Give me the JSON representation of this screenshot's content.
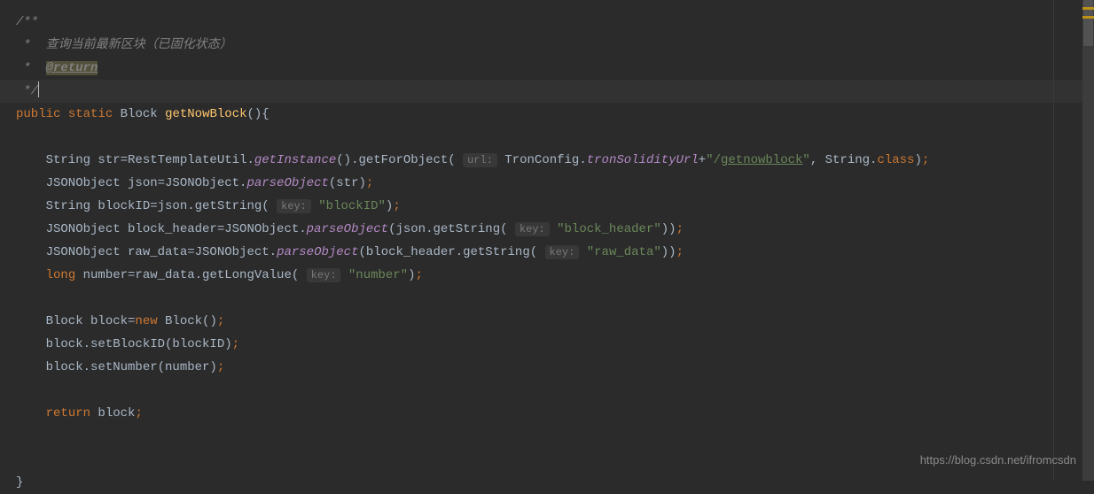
{
  "code": {
    "c1": "/**",
    "c2_star": " *  ",
    "c2_text": "查询当前最新区块（已固化状态）",
    "c3_star": " *  ",
    "c3_tag": "@return",
    "c4": " */",
    "l5_kw1": "public",
    "l5_kw2": "static",
    "l5_type": "Block",
    "l5_method": "getNowBlock",
    "l5_rest": "(){",
    "l7_a": "    String str=RestTemplateUtil.",
    "l7_m1": "getInstance",
    "l7_b": "().getForObject(",
    "l7_hint": "url:",
    "l7_c": " TronConfig.",
    "l7_sf": "tronSolidityUrl",
    "l7_d": "+",
    "l7_s1": "\"/",
    "l7_s2": "getnowblock",
    "l7_s3": "\"",
    "l7_e": ", String.",
    "l7_kw": "class",
    "l7_f": ")",
    "l7_semi": ";",
    "l8_a": "    JSONObject json=JSONObject.",
    "l8_m": "parseObject",
    "l8_b": "(str)",
    "l8_semi": ";",
    "l9_a": "    String blockID=json.getString(",
    "l9_hint": "key:",
    "l9_sp": " ",
    "l9_s": "\"blockID\"",
    "l9_b": ")",
    "l9_semi": ";",
    "l10_a": "    JSONObject block_header=JSONObject.",
    "l10_m": "parseObject",
    "l10_b": "(json.getString(",
    "l10_hint": "key:",
    "l10_sp": " ",
    "l10_s": "\"block_header\"",
    "l10_c": "))",
    "l10_semi": ";",
    "l11_a": "    JSONObject raw_data=JSONObject.",
    "l11_m": "parseObject",
    "l11_b": "(block_header.getString(",
    "l11_hint": "key:",
    "l11_sp": " ",
    "l11_s": "\"raw_data\"",
    "l11_c": "))",
    "l11_semi": ";",
    "l12_pre": "    ",
    "l12_kw": "long",
    "l12_a": " number=raw_data.getLongValue(",
    "l12_hint": "key:",
    "l12_sp": " ",
    "l12_s": "\"number\"",
    "l12_b": ")",
    "l12_semi": ";",
    "l14_a": "    Block block=",
    "l14_kw": "new",
    "l14_b": " Block()",
    "l14_semi": ";",
    "l15_a": "    block.setBlockID(blockID)",
    "l15_semi": ";",
    "l16_a": "    block.setNumber(number)",
    "l16_semi": ";",
    "l18_pre": "    ",
    "l18_kw": "return",
    "l18_a": " block",
    "l18_semi": ";",
    "l21": "}"
  },
  "watermark": "https://blog.csdn.net/ifromcsdn"
}
